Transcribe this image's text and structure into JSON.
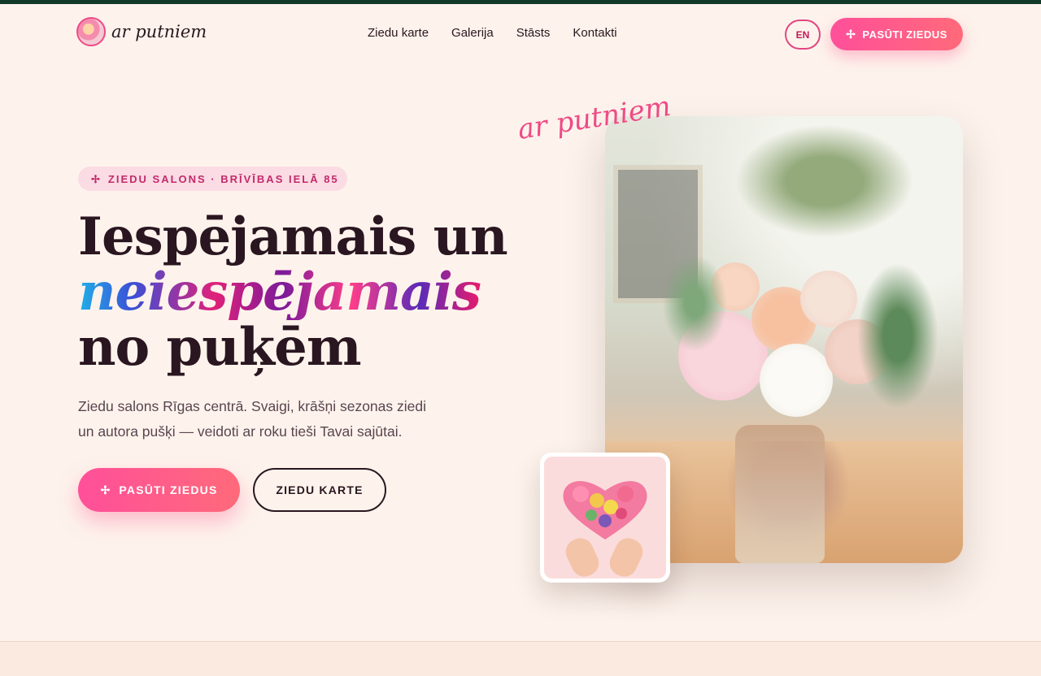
{
  "brand": {
    "name": "ar putniem"
  },
  "nav": {
    "links": [
      "Ziedu karte",
      "Galerija",
      "Stāsts",
      "Kontakti"
    ],
    "lang": "EN",
    "cta": "PASŪTI ZIEDUS"
  },
  "hero": {
    "badge": "ZIEDU SALONS · BRĪVĪBAS IELĀ 85",
    "headline_line1": "Iespējamais un",
    "headline_accent": "neiespējamais",
    "headline_line3": "no puķēm",
    "subtitle": "Ziedu salons Rīgas centrā. Svaigi, krāšņi sezonas ziedi un autora pušķi — veidoti ar roku tieši Tavai sajūtai.",
    "primary_button": "PASŪTI ZIEDUS",
    "secondary_button": "ZIEDU KARTE",
    "script_label": "ar putniem"
  },
  "icons": {
    "sparkle": "✢"
  },
  "colors": {
    "accent": "#ff4f9a",
    "topbar": "#123a2a",
    "background": "#fdf3ec",
    "text": "#2a1620"
  }
}
